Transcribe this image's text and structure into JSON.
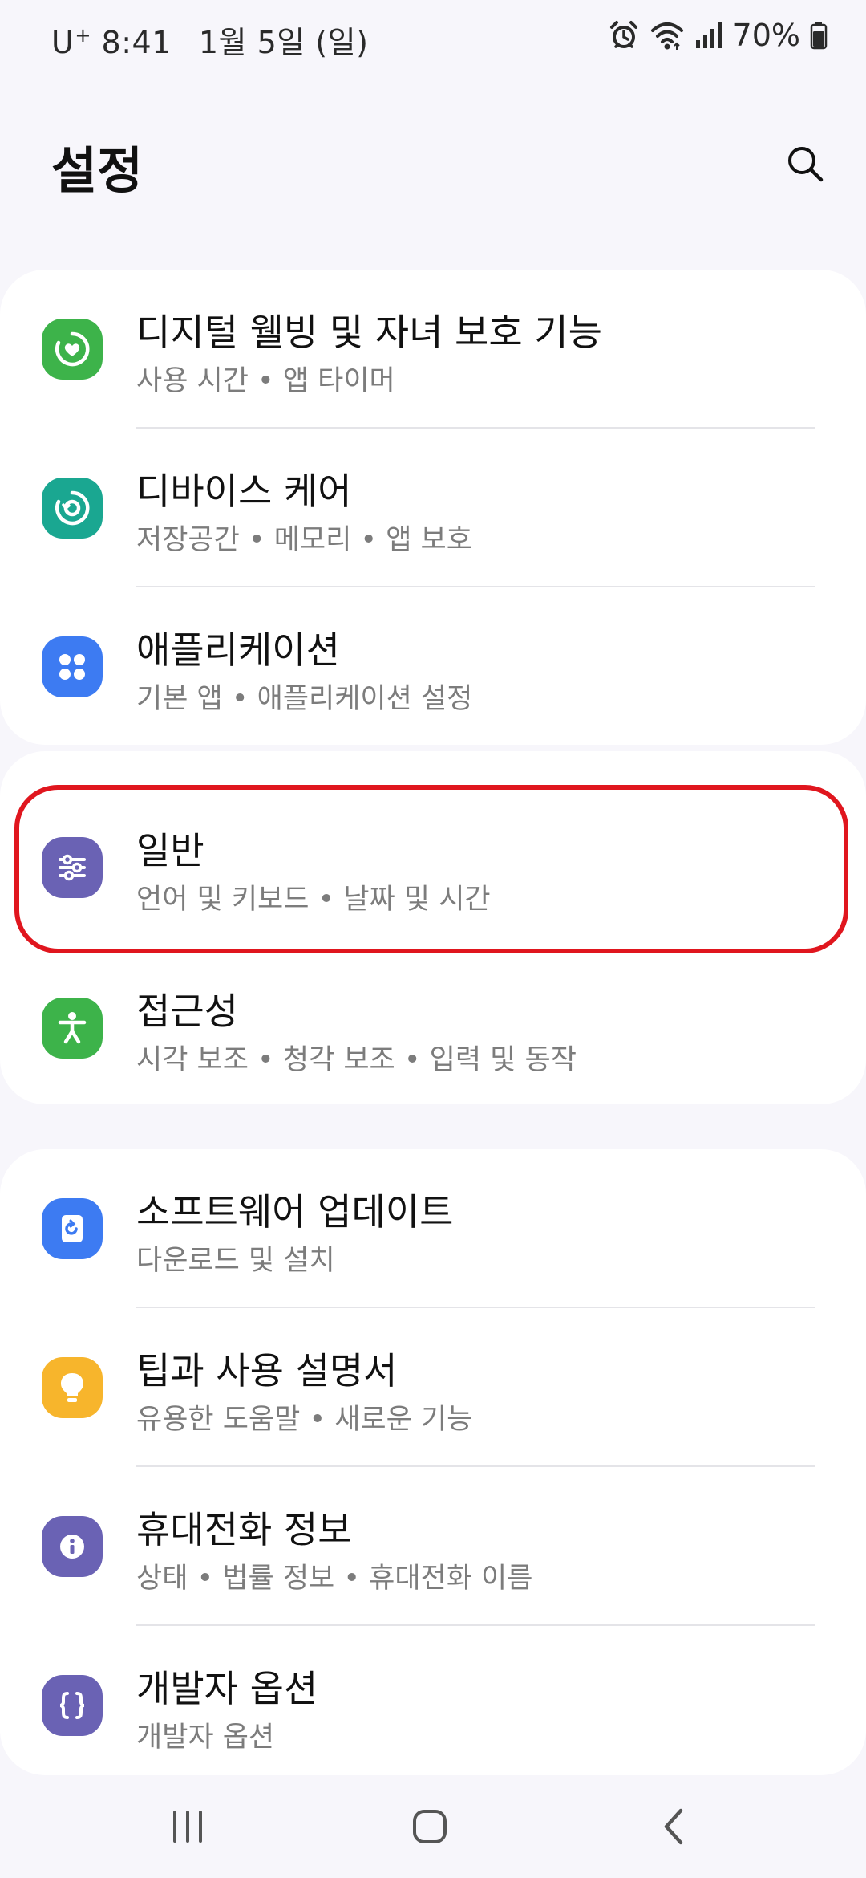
{
  "status_bar": {
    "carrier": "U",
    "carrier_sup": "+",
    "time": "8:41",
    "date": "1월 5일 (일)",
    "battery": "70%"
  },
  "header": {
    "title": "설정"
  },
  "groups": [
    {
      "items": [
        {
          "title": "디지털 웰빙 및 자녀 보호 기능",
          "subtitle": "사용 시간  •  앱 타이머",
          "icon": "digital-wellbeing-icon",
          "color": "#3db34a"
        },
        {
          "title": "디바이스 케어",
          "subtitle": "저장공간  •  메모리  •  앱 보호",
          "icon": "device-care-icon",
          "color": "#1aa791"
        },
        {
          "title": "애플리케이션",
          "subtitle": "기본 앱  •  애플리케이션 설정",
          "icon": "apps-icon",
          "color": "#3d7bf2"
        }
      ]
    },
    {
      "items": [
        {
          "title": "일반",
          "subtitle": "언어 및 키보드  •  날짜 및 시간",
          "icon": "general-management-icon",
          "color": "#6a62b4"
        },
        {
          "title": "접근성",
          "subtitle": "시각 보조  •  청각 보조  •  입력 및 동작",
          "icon": "accessibility-icon",
          "color": "#3db34a"
        }
      ]
    },
    {
      "items": [
        {
          "title": "소프트웨어 업데이트",
          "subtitle": "다운로드 및 설치",
          "icon": "software-update-icon",
          "color": "#3d7bf2"
        },
        {
          "title": "팁과 사용 설명서",
          "subtitle": "유용한 도움말  •  새로운 기능",
          "icon": "tips-icon",
          "color": "#f7b52c"
        },
        {
          "title": "휴대전화 정보",
          "subtitle": "상태  •  법률 정보  •  휴대전화 이름",
          "icon": "info-icon",
          "color": "#6a62b4"
        },
        {
          "title": "개발자 옵션",
          "subtitle": "개발자 옵션",
          "icon": "developer-options-icon",
          "color": "#6a62b4"
        }
      ]
    }
  ],
  "highlight_color": "#e0161e",
  "nav_bar": {
    "recents": "recents-icon",
    "home": "home-icon",
    "back": "back-icon"
  }
}
